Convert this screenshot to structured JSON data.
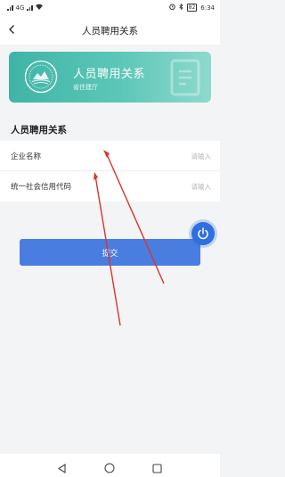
{
  "status_bar": {
    "time": "6:34",
    "battery": "82",
    "network": "4G"
  },
  "header": {
    "title": "人员聘用关系"
  },
  "banner": {
    "title": "人员聘用关系",
    "subtitle": "省住建厅",
    "accent_color": "#3fb4a6"
  },
  "section": {
    "title": "人员聘用关系"
  },
  "form": {
    "fields": [
      {
        "label": "企业名称",
        "value": "",
        "placeholder": "请输入"
      },
      {
        "label": "统一社会信用代码",
        "value": "",
        "placeholder": "请输入"
      }
    ]
  },
  "actions": {
    "submit_label": "提交",
    "primary_color": "#4a7de0"
  },
  "icons": [
    "back-icon",
    "seal-logo-icon",
    "power-icon",
    "back-triangle-icon",
    "home-circle-icon",
    "recent-square-icon"
  ]
}
